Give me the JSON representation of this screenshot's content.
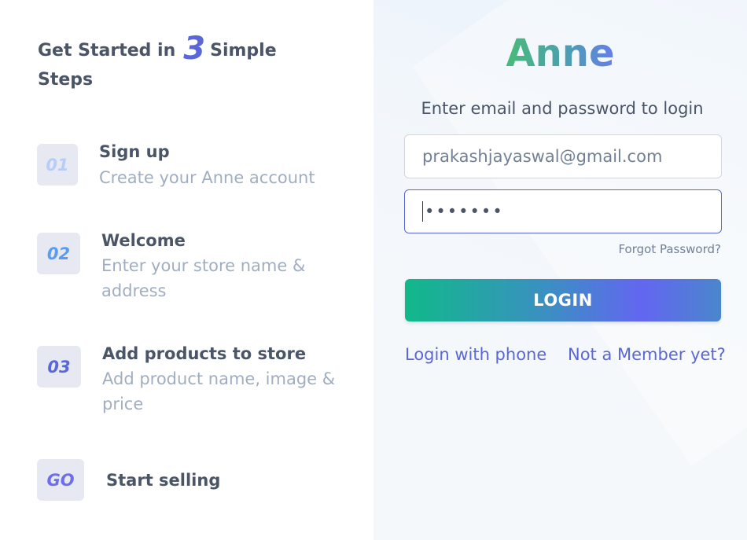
{
  "intro": {
    "heading_prefix": "Get Started in",
    "heading_number": "3",
    "heading_suffix": "Simple Steps"
  },
  "steps": [
    {
      "badge": "01",
      "title": "Sign up",
      "description": "Create your Anne account"
    },
    {
      "badge": "02",
      "title": "Welcome",
      "description": "Enter your store name & address"
    },
    {
      "badge": "03",
      "title": "Add products to store",
      "description": "Add product name, image & price"
    },
    {
      "badge": "GO",
      "title": "Start selling"
    }
  ],
  "login": {
    "brand": "Anne",
    "subtitle": "Enter email and password to login",
    "email_value": "prakashjayaswal@gmail.com",
    "password_mask": "•••••••",
    "forgot_label": "Forgot Password?",
    "login_button": "LOGIN",
    "phone_link": "Login with phone",
    "member_link": "Not a Member yet?"
  },
  "colors": {
    "accent": "#5a67d8",
    "badge_01": "#b7cdf7",
    "badge_02": "#5b9bf0",
    "badge_03": "#5a67d8",
    "badge_go": "#6f6cf0"
  }
}
